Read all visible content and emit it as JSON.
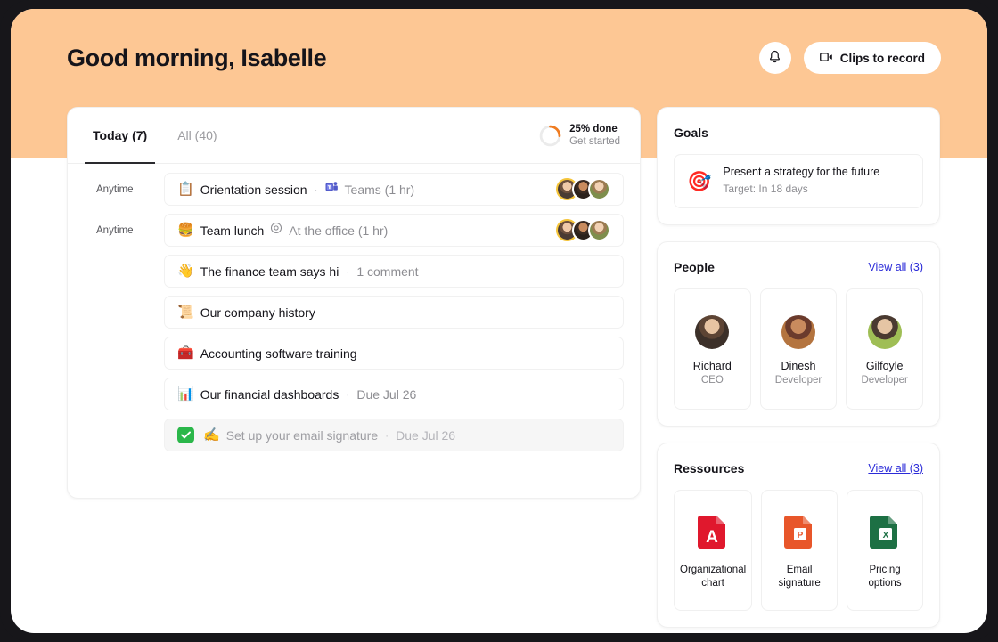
{
  "header": {
    "greeting": "Good morning, Isabelle",
    "bell_icon": "bell-icon",
    "clips_label": "Clips to record",
    "clips_icon": "video-camera-icon"
  },
  "tasks": {
    "tabs": [
      {
        "label": "Today (7)",
        "active": true
      },
      {
        "label": "All (40)",
        "active": false
      }
    ],
    "progress": {
      "percent": 25,
      "main_label": "25% done",
      "sub_label": "Get started",
      "ring_color": "#f07c21",
      "track_color": "#ebebeb"
    },
    "rows": [
      {
        "time": "Anytime",
        "emoji": "📋",
        "title": "Orientation session",
        "sep": "·",
        "meta_icon": "teams-icon",
        "meta": "Teams (1 hr)",
        "avatars": 3,
        "done": false
      },
      {
        "time": "Anytime",
        "emoji": "🍔",
        "title": "Team lunch",
        "sep": "",
        "meta_icon": "location-icon",
        "meta": "At the office (1 hr)",
        "avatars": 3,
        "done": false
      },
      {
        "time": "",
        "emoji": "👋",
        "title": "The finance team says hi",
        "sep": "·",
        "meta_icon": "",
        "meta": "1 comment",
        "avatars": 0,
        "done": false
      },
      {
        "time": "",
        "emoji": "📜",
        "title": "Our company history",
        "sep": "",
        "meta_icon": "",
        "meta": "",
        "avatars": 0,
        "done": false
      },
      {
        "time": "",
        "emoji": "🧰",
        "title": "Accounting software training",
        "sep": "",
        "meta_icon": "",
        "meta": "",
        "avatars": 0,
        "done": false
      },
      {
        "time": "",
        "emoji": "📊",
        "title": "Our financial dashboards",
        "sep": "·",
        "meta_icon": "",
        "meta": "Due Jul 26",
        "avatars": 0,
        "done": false
      },
      {
        "time": "",
        "emoji": "✍️",
        "title": "Set up your email signature",
        "sep": "·",
        "meta_icon": "",
        "meta": "Due Jul 26",
        "avatars": 0,
        "done": true
      }
    ]
  },
  "goals": {
    "title": "Goals",
    "items": [
      {
        "emoji": "🎯",
        "name": "Present a strategy for the future",
        "target": "Target: In 18 days"
      }
    ]
  },
  "people": {
    "title": "People",
    "view_all": "View all (3)",
    "items": [
      {
        "name": "Richard",
        "role": "CEO"
      },
      {
        "name": "Dinesh",
        "role": "Developer"
      },
      {
        "name": "Gilfoyle",
        "role": "Developer"
      }
    ]
  },
  "resources": {
    "title": "Ressources",
    "view_all": "View all (3)",
    "items": [
      {
        "name": "Organizational chart",
        "icon": "pdf-file-icon",
        "color": "#e0182d"
      },
      {
        "name": "Email signature",
        "icon": "powerpoint-file-icon",
        "color": "#e8562a"
      },
      {
        "name": "Pricing options",
        "icon": "excel-file-icon",
        "color": "#1d7044"
      }
    ]
  }
}
